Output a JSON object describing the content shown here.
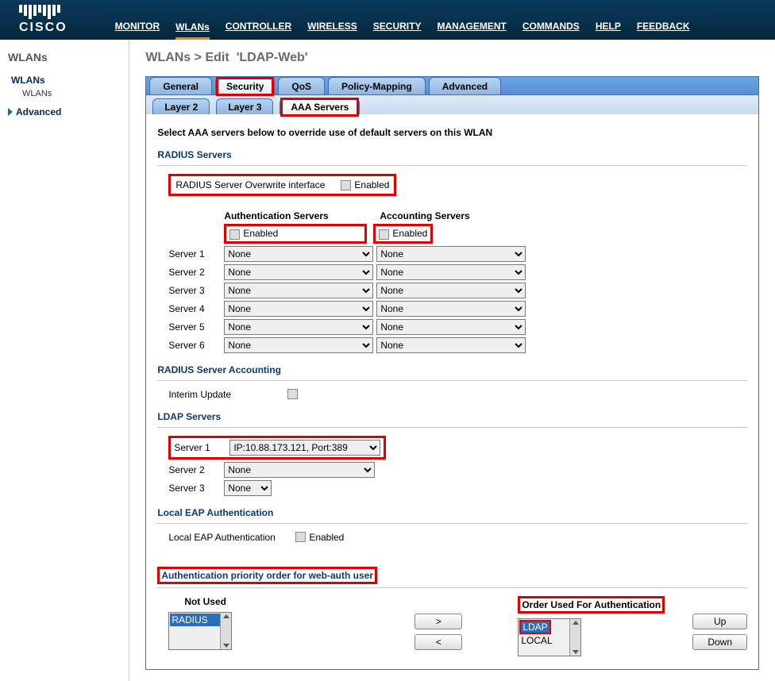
{
  "brand": "CISCO",
  "nav": [
    "MONITOR",
    "WLANs",
    "CONTROLLER",
    "WIRELESS",
    "SECURITY",
    "MANAGEMENT",
    "COMMANDS",
    "HELP",
    "FEEDBACK"
  ],
  "nav_active": "WLANs",
  "sidebar": {
    "title": "WLANs",
    "items": [
      {
        "label": "WLANs",
        "expanded": true,
        "children": [
          {
            "label": "WLANs"
          }
        ]
      },
      {
        "label": "Advanced",
        "expanded": false
      }
    ]
  },
  "breadcrumb": {
    "root": "WLANs",
    "sep": ">",
    "action": "Edit",
    "name": "'LDAP-Web'"
  },
  "tabs": [
    "General",
    "Security",
    "QoS",
    "Policy-Mapping",
    "Advanced"
  ],
  "tabs_active": "Security",
  "subtabs": [
    "Layer 2",
    "Layer 3",
    "AAA Servers"
  ],
  "subtabs_active": "AAA Servers",
  "instruction": "Select AAA servers below to override use of default servers on this WLAN",
  "radius": {
    "title": "RADIUS Servers",
    "overwrite_label": "RADIUS Server Overwrite interface",
    "enabled_label": "Enabled",
    "auth_header": "Authentication Servers",
    "acct_header": "Accounting Servers",
    "rows": [
      {
        "label": "Server 1",
        "auth": "None",
        "acct": "None"
      },
      {
        "label": "Server 2",
        "auth": "None",
        "acct": "None"
      },
      {
        "label": "Server 3",
        "auth": "None",
        "acct": "None"
      },
      {
        "label": "Server 4",
        "auth": "None",
        "acct": "None"
      },
      {
        "label": "Server 5",
        "auth": "None",
        "acct": "None"
      },
      {
        "label": "Server 6",
        "auth": "None",
        "acct": "None"
      }
    ],
    "accounting_title": "RADIUS Server Accounting",
    "interim_label": "Interim Update"
  },
  "ldap": {
    "title": "LDAP Servers",
    "rows": [
      {
        "label": "Server 1",
        "value": "IP:10.88.173.121, Port:389"
      },
      {
        "label": "Server 2",
        "value": "None"
      },
      {
        "label": "Server 3",
        "value": "None"
      }
    ]
  },
  "localeap": {
    "title": "Local EAP Authentication",
    "row_label": "Local EAP Authentication",
    "enabled_label": "Enabled"
  },
  "authprio": {
    "title": "Authentication priority order for web-auth user",
    "not_used_label": "Not Used",
    "order_label": "Order Used For Authentication",
    "not_used": [
      "RADIUS"
    ],
    "order": [
      "LDAP",
      "LOCAL"
    ],
    "btn_right": ">",
    "btn_left": "<",
    "btn_up": "Up",
    "btn_down": "Down"
  }
}
